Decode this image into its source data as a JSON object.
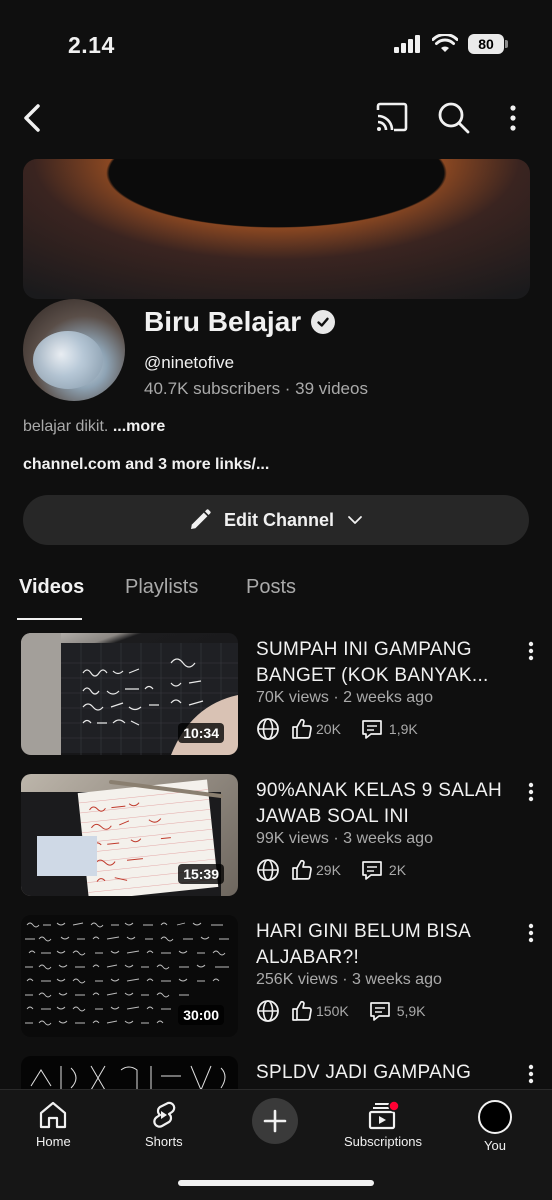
{
  "status_bar": {
    "time": "2.14",
    "battery": "80"
  },
  "topnav": {
    "back_icon": "chevron-left-icon",
    "cast_icon": "cast-icon",
    "search_icon": "search-icon",
    "more_icon": "more-vertical-icon"
  },
  "channel": {
    "name": "Biru Belajar",
    "handle": "@ninetofive",
    "stats": "40.7K subscribers · 39 videos",
    "description": "belajar dikit.",
    "more_label": "...more",
    "links": "channel.com and 3 more links/..."
  },
  "edit_button": {
    "label": "Edit Channel"
  },
  "tabs": [
    {
      "label": "Videos",
      "active": true
    },
    {
      "label": "Playlists",
      "active": false
    },
    {
      "label": "Posts",
      "active": false
    }
  ],
  "videos": [
    {
      "title": "SUMPAH INI GAMPANG BANGET (KOK BANYAK...",
      "meta": "70K views · 2 weeks ago",
      "likes": "20K",
      "comments": "1,9K",
      "duration": "10:34"
    },
    {
      "title": "90%ANAK KELAS 9 SALAH JAWAB SOAL INI",
      "meta": "99K views · 3 weeks ago",
      "likes": "29K",
      "comments": "2K",
      "duration": "15:39"
    },
    {
      "title": "HARI GINI BELUM BISA ALJABAR?!",
      "meta": "256K views · 3 weeks ago",
      "likes": "150K",
      "comments": "5,9K",
      "duration": "30:00"
    },
    {
      "title": "SPLDV JADI GAMPANG (BUKAN CLICKBAIT!)",
      "meta": "",
      "likes": "",
      "comments": "",
      "duration": ""
    }
  ],
  "bottom_nav": {
    "home": "Home",
    "shorts": "Shorts",
    "subscriptions": "Subscriptions",
    "you": "You"
  },
  "colors": {
    "background": "#0f0f0f",
    "surface": "#272727",
    "text": "#f1f1f1",
    "secondary": "#aaaaaa",
    "notification": "#ff0033"
  }
}
